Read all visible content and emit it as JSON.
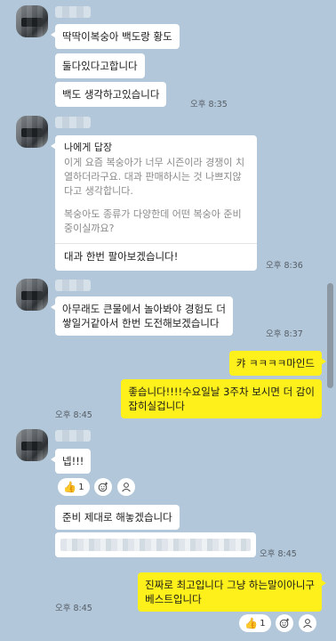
{
  "messages": {
    "m1": "딱딱이복숭아 백도랑 황도",
    "m2": "둘다있다고합니다",
    "m3": "백도 생각하고있습니다",
    "m3_time": "오후 8:35",
    "reply": {
      "title": "나에게 답장",
      "quote_1": "이게 요즘 복숭아가 너무 시즌이라 경쟁이 치열하더라구요. 대과 판매하시는 것 나쁘지않다고 생각합니다.",
      "quote_2": "복숭아도 종류가 다양한데 어떤 복숭아 준비중이실까요?",
      "answer": "대과 한번 팔아보겠습니다!",
      "time": "오후 8:36"
    },
    "m4_line1": "아무래도 큰물에서 놀아봐야 경험도 더",
    "m4_line2": "쌓일거같아서 한번 도전해보겠습니다",
    "m4_time": "오후 8:37",
    "me1": "캬 ㅋㅋㅋㅋ마인드",
    "me2_line1": "좋습니다!!!!수요일날 3주차 보시면 더 감이",
    "me2_line2": "잡히실겁니다",
    "me2_time": "오후 8:45",
    "m5": "넵!!!",
    "m5_reaction_count": "1",
    "m6": "준비 제대로 해놓겠습니다",
    "m7_time": "오후 8:45",
    "me3_line1": "진짜로 최고입니다 그냥 하는말이아니구",
    "me3_line2": "베스트입니다",
    "me3_time": "오후 8:45",
    "me3_reaction_count": "1"
  },
  "icons": {
    "reaction_emoji": "thumbs-up",
    "add_reaction": "smile-plus-icon",
    "reaction_members": "person-icon"
  },
  "colors": {
    "background": "#b2c7d9",
    "my_bubble": "#fef01b",
    "their_bubble": "#ffffff"
  }
}
